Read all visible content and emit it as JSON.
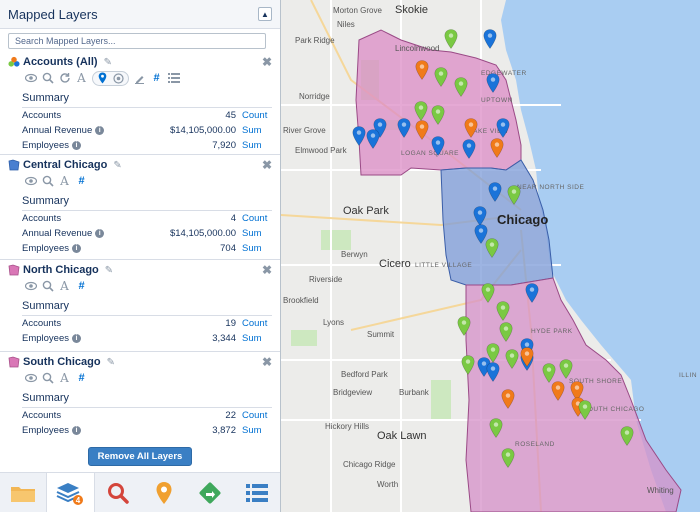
{
  "panel": {
    "title": "Mapped Layers",
    "collapse_icon": "caret-up-icon",
    "search_placeholder": "Search Mapped Layers..."
  },
  "layers": [
    {
      "name": "Accounts (All)",
      "icon": "multi-color-pin-icon",
      "summary_title": "Summary",
      "rows": [
        {
          "label": "Accounts",
          "value": "45",
          "agg": "Count",
          "info": false
        },
        {
          "label": "Annual Revenue",
          "value": "$14,105,000.00",
          "agg": "Sum",
          "info": true
        },
        {
          "label": "Employees",
          "value": "7,920",
          "agg": "Sum",
          "info": true
        }
      ]
    },
    {
      "name": "Central Chicago",
      "icon": "blue-territory-icon",
      "color": "#4a7fd0",
      "summary_title": "Summary",
      "rows": [
        {
          "label": "Accounts",
          "value": "4",
          "agg": "Count",
          "info": false
        },
        {
          "label": "Annual Revenue",
          "value": "$14,105,000.00",
          "agg": "Sum",
          "info": true
        },
        {
          "label": "Employees",
          "value": "704",
          "agg": "Sum",
          "info": true
        }
      ]
    },
    {
      "name": "North Chicago",
      "icon": "pink-territory-icon",
      "color": "#d977b6",
      "summary_title": "Summary",
      "rows": [
        {
          "label": "Accounts",
          "value": "19",
          "agg": "Count",
          "info": false
        },
        {
          "label": "Employees",
          "value": "3,344",
          "agg": "Sum",
          "info": true
        }
      ]
    },
    {
      "name": "South Chicago",
      "icon": "pink-territory-icon",
      "color": "#d977b6",
      "summary_title": "Summary",
      "rows": [
        {
          "label": "Accounts",
          "value": "22",
          "agg": "Count",
          "info": false
        },
        {
          "label": "Employees",
          "value": "3,872",
          "agg": "Sum",
          "info": true
        }
      ]
    }
  ],
  "remove_all_label": "Remove All Layers",
  "bottom_tabs": [
    {
      "name": "folder-icon",
      "color": "#f2b654"
    },
    {
      "name": "layers-icon",
      "color": "#3a7fc4",
      "badge": "4",
      "active": true
    },
    {
      "name": "search-icon",
      "color": "#d4453b"
    },
    {
      "name": "map-pin-icon",
      "color": "#f0a030"
    },
    {
      "name": "route-icon",
      "color": "#3fa85c"
    },
    {
      "name": "list-icon",
      "color": "#3a7fc4"
    }
  ],
  "map": {
    "labels": [
      {
        "text": "Skokie",
        "cls": "big"
      },
      {
        "text": "Lincolnwood",
        "cls": ""
      },
      {
        "text": "Park Ridge",
        "cls": ""
      },
      {
        "text": "Niles",
        "cls": ""
      },
      {
        "text": "Morton Grove",
        "cls": ""
      },
      {
        "text": "Norridge",
        "cls": ""
      },
      {
        "text": "Elmwood Park",
        "cls": ""
      },
      {
        "text": "River Grove",
        "cls": ""
      },
      {
        "text": "Oak Park",
        "cls": "big"
      },
      {
        "text": "Chicago",
        "cls": "city"
      },
      {
        "text": "Berwyn",
        "cls": ""
      },
      {
        "text": "Cicero",
        "cls": "big"
      },
      {
        "text": "LITTLE VILLAGE",
        "cls": "hood"
      },
      {
        "text": "Riverside",
        "cls": ""
      },
      {
        "text": "Brookfield",
        "cls": ""
      },
      {
        "text": "Lyons",
        "cls": ""
      },
      {
        "text": "Summit",
        "cls": ""
      },
      {
        "text": "Bedford Park",
        "cls": ""
      },
      {
        "text": "Burbank",
        "cls": ""
      },
      {
        "text": "Bridgeview",
        "cls": ""
      },
      {
        "text": "Hickory Hills",
        "cls": ""
      },
      {
        "text": "Oak Lawn",
        "cls": "big"
      },
      {
        "text": "Chicago Ridge",
        "cls": ""
      },
      {
        "text": "Worth",
        "cls": ""
      },
      {
        "text": "HYDE PARK",
        "cls": "hood"
      },
      {
        "text": "SOUTH SHORE",
        "cls": "hood"
      },
      {
        "text": "SOUTH CHICAGO",
        "cls": "hood"
      },
      {
        "text": "ROSELAND",
        "cls": "hood"
      },
      {
        "text": "Whiting",
        "cls": ""
      },
      {
        "text": "ILLIN",
        "cls": "hood"
      },
      {
        "text": "EDGEWATER",
        "cls": "hood"
      },
      {
        "text": "UPTOWN",
        "cls": "hood"
      },
      {
        "text": "LOGAN SQUARE",
        "cls": "hood"
      },
      {
        "text": "LAKE VIEW",
        "cls": "hood"
      },
      {
        "text": "NEAR NORTH SIDE",
        "cls": "hood"
      }
    ],
    "colors": {
      "land": "#ececea",
      "water": "#a9cdf2",
      "park": "#cde8c0",
      "north_region": "#dc8cc5",
      "central_region": "#7c9bd8",
      "south_region": "#d690c8",
      "pin_blue": "#1a73d9",
      "pin_green": "#7ac943",
      "pin_orange": "#f07a1a"
    }
  }
}
